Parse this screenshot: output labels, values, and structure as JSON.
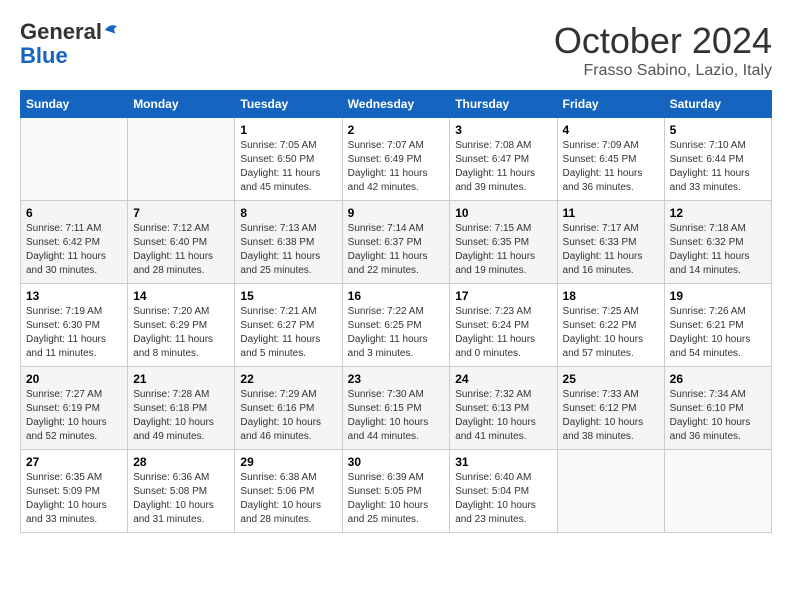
{
  "logo": {
    "general": "General",
    "blue": "Blue"
  },
  "title": "October 2024",
  "location": "Frasso Sabino, Lazio, Italy",
  "days_of_week": [
    "Sunday",
    "Monday",
    "Tuesday",
    "Wednesday",
    "Thursday",
    "Friday",
    "Saturday"
  ],
  "weeks": [
    [
      {
        "day": "",
        "sunrise": "",
        "sunset": "",
        "daylight": ""
      },
      {
        "day": "",
        "sunrise": "",
        "sunset": "",
        "daylight": ""
      },
      {
        "day": "1",
        "sunrise": "Sunrise: 7:05 AM",
        "sunset": "Sunset: 6:50 PM",
        "daylight": "Daylight: 11 hours and 45 minutes."
      },
      {
        "day": "2",
        "sunrise": "Sunrise: 7:07 AM",
        "sunset": "Sunset: 6:49 PM",
        "daylight": "Daylight: 11 hours and 42 minutes."
      },
      {
        "day": "3",
        "sunrise": "Sunrise: 7:08 AM",
        "sunset": "Sunset: 6:47 PM",
        "daylight": "Daylight: 11 hours and 39 minutes."
      },
      {
        "day": "4",
        "sunrise": "Sunrise: 7:09 AM",
        "sunset": "Sunset: 6:45 PM",
        "daylight": "Daylight: 11 hours and 36 minutes."
      },
      {
        "day": "5",
        "sunrise": "Sunrise: 7:10 AM",
        "sunset": "Sunset: 6:44 PM",
        "daylight": "Daylight: 11 hours and 33 minutes."
      }
    ],
    [
      {
        "day": "6",
        "sunrise": "Sunrise: 7:11 AM",
        "sunset": "Sunset: 6:42 PM",
        "daylight": "Daylight: 11 hours and 30 minutes."
      },
      {
        "day": "7",
        "sunrise": "Sunrise: 7:12 AM",
        "sunset": "Sunset: 6:40 PM",
        "daylight": "Daylight: 11 hours and 28 minutes."
      },
      {
        "day": "8",
        "sunrise": "Sunrise: 7:13 AM",
        "sunset": "Sunset: 6:38 PM",
        "daylight": "Daylight: 11 hours and 25 minutes."
      },
      {
        "day": "9",
        "sunrise": "Sunrise: 7:14 AM",
        "sunset": "Sunset: 6:37 PM",
        "daylight": "Daylight: 11 hours and 22 minutes."
      },
      {
        "day": "10",
        "sunrise": "Sunrise: 7:15 AM",
        "sunset": "Sunset: 6:35 PM",
        "daylight": "Daylight: 11 hours and 19 minutes."
      },
      {
        "day": "11",
        "sunrise": "Sunrise: 7:17 AM",
        "sunset": "Sunset: 6:33 PM",
        "daylight": "Daylight: 11 hours and 16 minutes."
      },
      {
        "day": "12",
        "sunrise": "Sunrise: 7:18 AM",
        "sunset": "Sunset: 6:32 PM",
        "daylight": "Daylight: 11 hours and 14 minutes."
      }
    ],
    [
      {
        "day": "13",
        "sunrise": "Sunrise: 7:19 AM",
        "sunset": "Sunset: 6:30 PM",
        "daylight": "Daylight: 11 hours and 11 minutes."
      },
      {
        "day": "14",
        "sunrise": "Sunrise: 7:20 AM",
        "sunset": "Sunset: 6:29 PM",
        "daylight": "Daylight: 11 hours and 8 minutes."
      },
      {
        "day": "15",
        "sunrise": "Sunrise: 7:21 AM",
        "sunset": "Sunset: 6:27 PM",
        "daylight": "Daylight: 11 hours and 5 minutes."
      },
      {
        "day": "16",
        "sunrise": "Sunrise: 7:22 AM",
        "sunset": "Sunset: 6:25 PM",
        "daylight": "Daylight: 11 hours and 3 minutes."
      },
      {
        "day": "17",
        "sunrise": "Sunrise: 7:23 AM",
        "sunset": "Sunset: 6:24 PM",
        "daylight": "Daylight: 11 hours and 0 minutes."
      },
      {
        "day": "18",
        "sunrise": "Sunrise: 7:25 AM",
        "sunset": "Sunset: 6:22 PM",
        "daylight": "Daylight: 10 hours and 57 minutes."
      },
      {
        "day": "19",
        "sunrise": "Sunrise: 7:26 AM",
        "sunset": "Sunset: 6:21 PM",
        "daylight": "Daylight: 10 hours and 54 minutes."
      }
    ],
    [
      {
        "day": "20",
        "sunrise": "Sunrise: 7:27 AM",
        "sunset": "Sunset: 6:19 PM",
        "daylight": "Daylight: 10 hours and 52 minutes."
      },
      {
        "day": "21",
        "sunrise": "Sunrise: 7:28 AM",
        "sunset": "Sunset: 6:18 PM",
        "daylight": "Daylight: 10 hours and 49 minutes."
      },
      {
        "day": "22",
        "sunrise": "Sunrise: 7:29 AM",
        "sunset": "Sunset: 6:16 PM",
        "daylight": "Daylight: 10 hours and 46 minutes."
      },
      {
        "day": "23",
        "sunrise": "Sunrise: 7:30 AM",
        "sunset": "Sunset: 6:15 PM",
        "daylight": "Daylight: 10 hours and 44 minutes."
      },
      {
        "day": "24",
        "sunrise": "Sunrise: 7:32 AM",
        "sunset": "Sunset: 6:13 PM",
        "daylight": "Daylight: 10 hours and 41 minutes."
      },
      {
        "day": "25",
        "sunrise": "Sunrise: 7:33 AM",
        "sunset": "Sunset: 6:12 PM",
        "daylight": "Daylight: 10 hours and 38 minutes."
      },
      {
        "day": "26",
        "sunrise": "Sunrise: 7:34 AM",
        "sunset": "Sunset: 6:10 PM",
        "daylight": "Daylight: 10 hours and 36 minutes."
      }
    ],
    [
      {
        "day": "27",
        "sunrise": "Sunrise: 6:35 AM",
        "sunset": "Sunset: 5:09 PM",
        "daylight": "Daylight: 10 hours and 33 minutes."
      },
      {
        "day": "28",
        "sunrise": "Sunrise: 6:36 AM",
        "sunset": "Sunset: 5:08 PM",
        "daylight": "Daylight: 10 hours and 31 minutes."
      },
      {
        "day": "29",
        "sunrise": "Sunrise: 6:38 AM",
        "sunset": "Sunset: 5:06 PM",
        "daylight": "Daylight: 10 hours and 28 minutes."
      },
      {
        "day": "30",
        "sunrise": "Sunrise: 6:39 AM",
        "sunset": "Sunset: 5:05 PM",
        "daylight": "Daylight: 10 hours and 25 minutes."
      },
      {
        "day": "31",
        "sunrise": "Sunrise: 6:40 AM",
        "sunset": "Sunset: 5:04 PM",
        "daylight": "Daylight: 10 hours and 23 minutes."
      },
      {
        "day": "",
        "sunrise": "",
        "sunset": "",
        "daylight": ""
      },
      {
        "day": "",
        "sunrise": "",
        "sunset": "",
        "daylight": ""
      }
    ]
  ]
}
